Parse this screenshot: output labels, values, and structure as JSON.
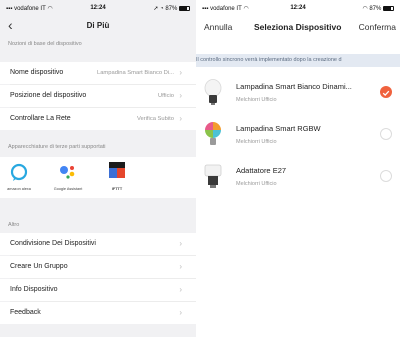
{
  "left_status": {
    "carrier": "vodafone IT",
    "time": "12:24",
    "battery": "87%"
  },
  "right_status": {
    "carrier": "vodafone IT",
    "time": "12:24",
    "battery": "87%"
  },
  "left": {
    "title": "Di Più",
    "section_basic": "Nozioni di base del dispositivo",
    "rows": [
      {
        "label": "Nome dispositivo",
        "value": "Lampadina Smart Bianco Di..."
      },
      {
        "label": "Posizione del dispositivo",
        "value": "Ufficio"
      },
      {
        "label": "Controllare La Rete",
        "value": "Verifica Subito"
      }
    ],
    "section_third": "Apparecchiature di terze parti supportati",
    "apps": [
      {
        "name": "amazon alexa"
      },
      {
        "name": "Google Assistant"
      },
      {
        "name": "IFTTT"
      }
    ],
    "section_other": "Altro",
    "other_rows": [
      {
        "label": "Condivisione Dei Dispositivi"
      },
      {
        "label": "Creare Un Gruppo"
      },
      {
        "label": "Info Dispositivo"
      },
      {
        "label": "Feedback"
      }
    ]
  },
  "right": {
    "cancel": "Annulla",
    "title": "Seleziona Dispositivo",
    "confirm": "Conferma",
    "banner": "Il controllo sincrono verrà implementato dopo la creazione d",
    "devices": [
      {
        "name": "Lampadina Smart Bianco Dinami...",
        "room": "Melchiorri Ufficio",
        "selected": true
      },
      {
        "name": "Lampadina Smart RGBW",
        "room": "Melchiorri Ufficio",
        "selected": false
      },
      {
        "name": "Adattatore E27",
        "room": "Melchiorri Ufficio",
        "selected": false
      }
    ]
  },
  "colors": {
    "accent": "#f0623e",
    "banner_bg": "#e3e9f2",
    "alexa_blue": "#28a8e0",
    "ifttt_dark": "#1b1b1b"
  }
}
